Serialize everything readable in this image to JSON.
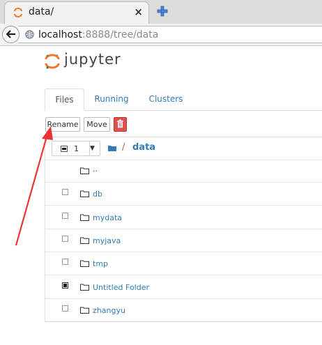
{
  "browser": {
    "tab_title": "data/",
    "tab_close": "×",
    "url_host": "localhost",
    "url_rest": ":8888/tree/data",
    "back_glyph": "🡐"
  },
  "jupyter": {
    "logo_text": "jupyter",
    "tabs": [
      "Files",
      "Running",
      "Clusters"
    ],
    "active_tab": "Files",
    "toolbar": {
      "rename_label": "Rename",
      "move_label": "Move",
      "delete_icon": "trash-icon"
    },
    "selection": {
      "count": "1",
      "caret": "▼"
    },
    "breadcrumb": {
      "separator": "/",
      "current": "data"
    },
    "files": [
      {
        "name": "..",
        "type": "updir",
        "checked": false
      },
      {
        "name": "db",
        "type": "folder",
        "checked": false
      },
      {
        "name": "mydata",
        "type": "folder",
        "checked": false
      },
      {
        "name": "myjava",
        "type": "folder",
        "checked": false
      },
      {
        "name": "tmp",
        "type": "folder",
        "checked": false
      },
      {
        "name": "Untitled Folder",
        "type": "folder",
        "checked": true
      },
      {
        "name": "zhangyu",
        "type": "folder",
        "checked": false
      }
    ]
  },
  "colors": {
    "link": "#337ab7",
    "delete": "#d9534f",
    "annotation_arrow": "#ee3333",
    "jupyter_orange": "#f37726"
  }
}
